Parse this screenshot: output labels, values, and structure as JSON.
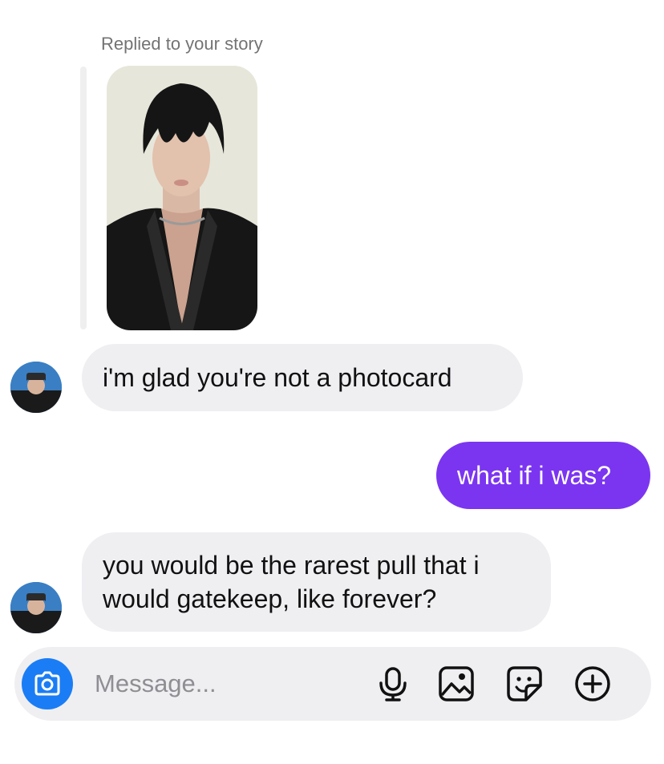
{
  "reply_context": {
    "label": "Replied to your story"
  },
  "messages": [
    {
      "direction": "incoming",
      "lines": [
        "i'm glad you're not a photocard"
      ]
    },
    {
      "direction": "outgoing",
      "lines": [
        "what if i was?"
      ]
    },
    {
      "direction": "incoming",
      "lines": [
        "you would be the rarest pull that i",
        "would gatekeep, like forever?"
      ]
    }
  ],
  "composer": {
    "placeholder": "Message...",
    "icons": [
      "camera-icon",
      "microphone-icon",
      "gallery-icon",
      "sticker-icon",
      "plus-icon"
    ]
  },
  "colors": {
    "outgoing_bubble": "#7b35f0",
    "incoming_bubble": "#efeff2",
    "camera_button": "#1b7df5",
    "secondary_text": "#737373"
  }
}
